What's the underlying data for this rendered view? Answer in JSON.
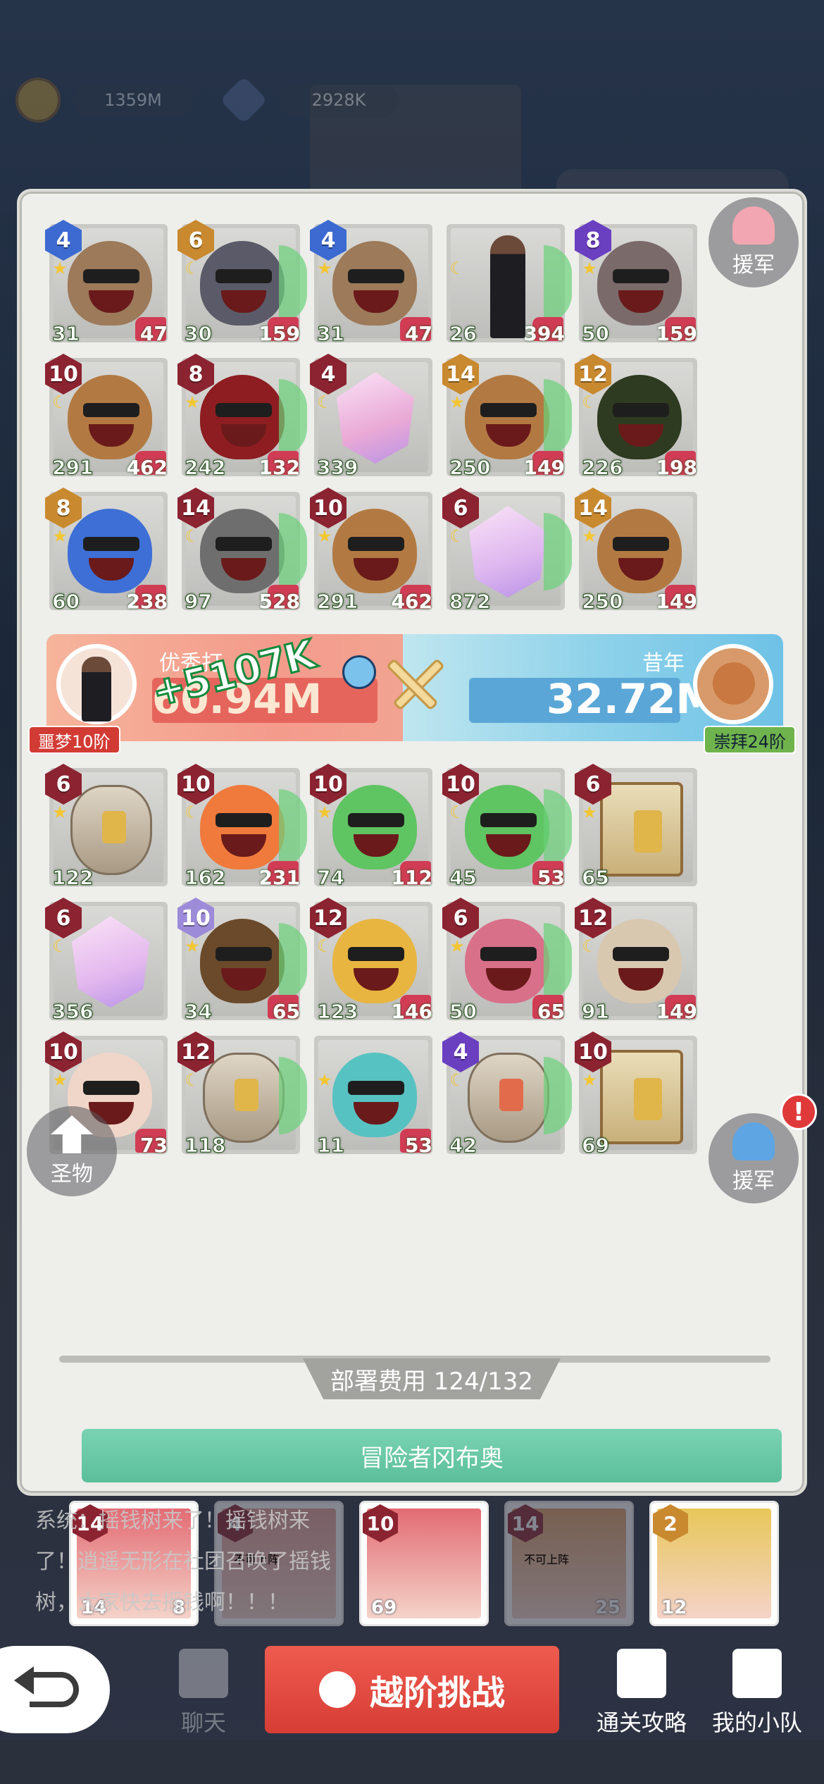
{
  "hud": {
    "gold": "1359M",
    "gems": "2928K"
  },
  "top_cards": [
    {
      "lvl": "4",
      "color": "blue",
      "atk": "31",
      "hp": "47",
      "bg": "#9c7a5a"
    },
    {
      "lvl": "6",
      "color": "gold",
      "atk": "30",
      "hp": "159",
      "bg": "#5a5a68"
    },
    {
      "lvl": "4",
      "color": "blue",
      "atk": "31",
      "hp": "47",
      "bg": "#9c7a5a"
    },
    {
      "lvl": "",
      "color": "",
      "atk": "26",
      "hp": "394",
      "bg": "#2b2b30"
    },
    {
      "lvl": "8",
      "color": "purple",
      "atk": "50",
      "hp": "159",
      "bg": "#7a6a6a"
    },
    {
      "lvl": "10",
      "color": "red",
      "atk": "291",
      "hp": "462",
      "bg": "#b27a42"
    },
    {
      "lvl": "8",
      "color": "red",
      "atk": "242",
      "hp": "132",
      "bg": "#8d1d20"
    },
    {
      "lvl": "4",
      "color": "red",
      "atk": "339",
      "hp": "",
      "bg": "#e9a9d6"
    },
    {
      "lvl": "14",
      "color": "gold",
      "atk": "250",
      "hp": "149",
      "bg": "#b27a42"
    },
    {
      "lvl": "12",
      "color": "gold",
      "atk": "226",
      "hp": "198",
      "bg": "#2f3b20"
    },
    {
      "lvl": "8",
      "color": "gold",
      "atk": "60",
      "hp": "238",
      "bg": "#3d6fd6"
    },
    {
      "lvl": "14",
      "color": "red",
      "atk": "97",
      "hp": "528",
      "bg": "#6e6e6e"
    },
    {
      "lvl": "10",
      "color": "red",
      "atk": "291",
      "hp": "462",
      "bg": "#b27a42"
    },
    {
      "lvl": "6",
      "color": "red",
      "atk": "872",
      "hp": "",
      "bg": "#ddb6ef"
    },
    {
      "lvl": "14",
      "color": "gold",
      "atk": "250",
      "hp": "149",
      "bg": "#b27a42"
    }
  ],
  "vs": {
    "left_name": "优秀打",
    "left_power": "60.94M",
    "bonus": "+5107K",
    "right_name": "昔年",
    "right_power": "32.72M",
    "left_tag": "噩梦10阶",
    "right_tag": "崇拜24阶"
  },
  "bottom_cards": [
    {
      "lvl": "6",
      "color": "red",
      "atk": "122",
      "hp": "",
      "bg": "#d9cbb2"
    },
    {
      "lvl": "10",
      "color": "red",
      "atk": "162",
      "hp": "231",
      "bg": "#ef7a3c"
    },
    {
      "lvl": "10",
      "color": "red",
      "atk": "74",
      "hp": "112",
      "bg": "#5fc462"
    },
    {
      "lvl": "10",
      "color": "red",
      "atk": "45",
      "hp": "53",
      "bg": "#5fc462"
    },
    {
      "lvl": "6",
      "color": "red",
      "atk": "65",
      "hp": "",
      "bg": "#e8d6a8"
    },
    {
      "lvl": "6",
      "color": "red",
      "atk": "356",
      "hp": "",
      "bg": "#e3b8ee"
    },
    {
      "lvl": "10",
      "color": "lilac",
      "atk": "34",
      "hp": "65",
      "bg": "#6a4a2a"
    },
    {
      "lvl": "12",
      "color": "red",
      "atk": "123",
      "hp": "146",
      "bg": "#e8b540"
    },
    {
      "lvl": "6",
      "color": "red",
      "atk": "50",
      "hp": "65",
      "bg": "#d8708a"
    },
    {
      "lvl": "12",
      "color": "red",
      "atk": "91",
      "hp": "149",
      "bg": "#d9c8b0"
    },
    {
      "lvl": "10",
      "color": "red",
      "atk": "",
      "hp": "73",
      "bg": "#f0d6c8"
    },
    {
      "lvl": "12",
      "color": "red",
      "atk": "118",
      "hp": "",
      "bg": "#d9cbb2"
    },
    {
      "lvl": "",
      "color": "",
      "atk": "11",
      "hp": "53",
      "bg": "#57c2c2"
    },
    {
      "lvl": "4",
      "color": "purple",
      "atk": "42",
      "hp": "",
      "bg": "#dccbb6"
    },
    {
      "lvl": "10",
      "color": "red",
      "atk": "69",
      "hp": "",
      "bg": "#e8d6a8"
    }
  ],
  "side": {
    "reinforce_top": "援军",
    "relic": "圣物",
    "reinforce_bottom": "援军",
    "alert": "!"
  },
  "cost_label": "部署费用 124/132",
  "adventurer": {
    "title": "冒险者冈布奥",
    "cards": [
      {
        "lvl": "14",
        "num": "14",
        "num2": "8",
        "blocked": ""
      },
      {
        "lvl": "4",
        "num": "",
        "num2": "",
        "blocked": "不可上阵"
      },
      {
        "lvl": "10",
        "num": "69",
        "num2": "",
        "blocked": ""
      },
      {
        "lvl": "14",
        "num": "",
        "num2": "25",
        "blocked": "不可上阵"
      },
      {
        "lvl": "2",
        "num": "12",
        "num2": "",
        "blocked": ""
      }
    ]
  },
  "chat_lines": [
    "系统：摇钱树来了！摇钱树来",
    "了！逍遥无形在社团召唤了摇钱",
    "树，大家快去摇钱啊！！！"
  ],
  "footer": {
    "challenge": "越阶挑战",
    "chat": "聊天",
    "guide": "通关攻略",
    "team": "我的小队"
  },
  "colors": {
    "accent_red": "#d63d35",
    "adventure_green": "#5bbf9a",
    "panel_bg": "#eeeeeb"
  }
}
